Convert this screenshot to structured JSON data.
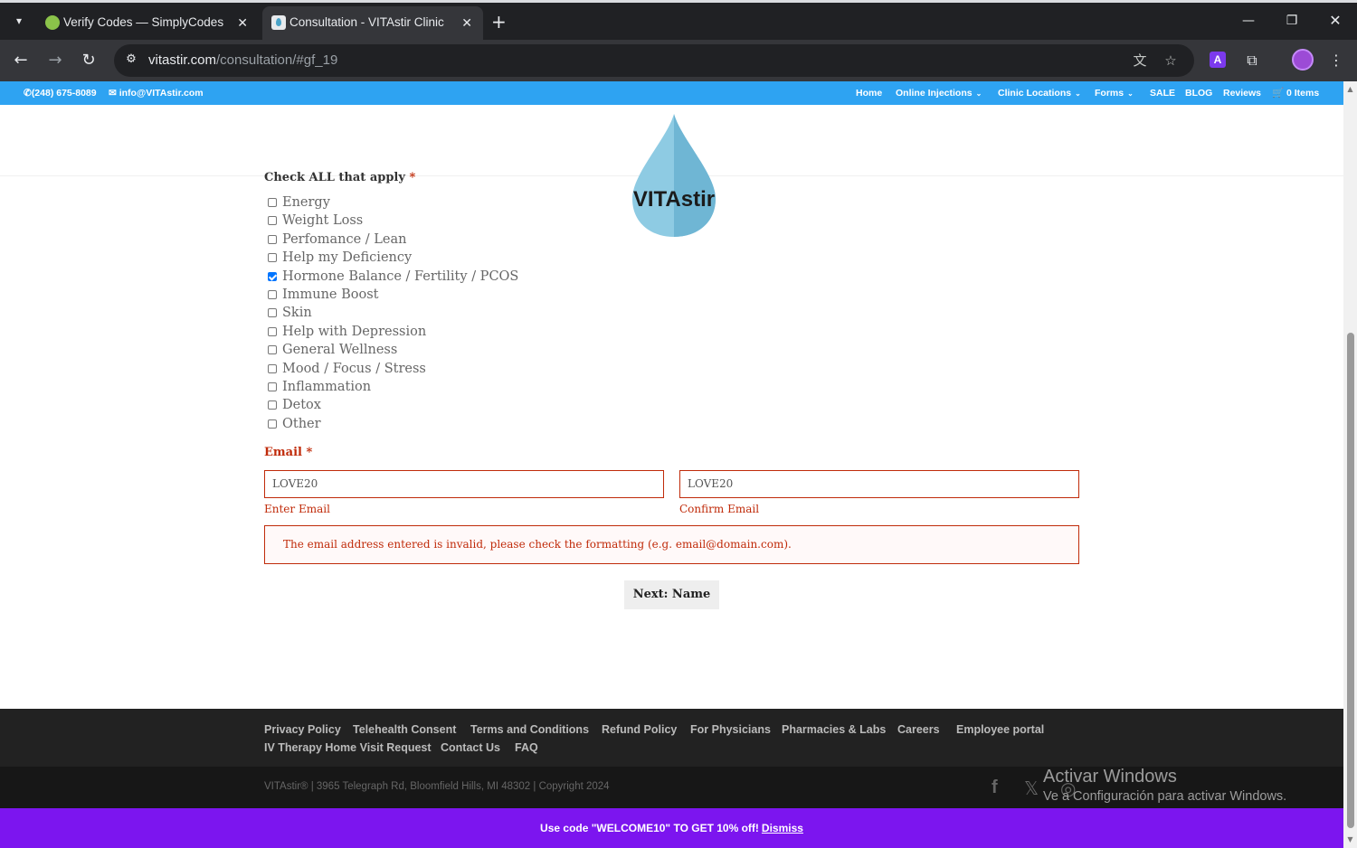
{
  "browser": {
    "tabs": [
      {
        "title": "Verify Codes — SimplyCodes",
        "active": false
      },
      {
        "title": "Consultation - VITAstir Clinic",
        "active": true
      }
    ],
    "url_host": "vitastir.com",
    "url_path": "/consultation/#gf_19",
    "icons": [
      "chevron-down-icon",
      "close-icon",
      "plus-icon",
      "minimize-icon",
      "restore-icon",
      "back-icon",
      "forward-icon",
      "reload-icon",
      "tune-icon",
      "translate-icon",
      "star-icon",
      "extension-icon",
      "profile-avatar",
      "kebab-menu-icon"
    ],
    "ext_a_label": "A"
  },
  "topbar": {
    "phone": "(248) 675-8089",
    "email": "info@VITAstir.com",
    "menu": [
      {
        "label": "Home",
        "dropdown": false
      },
      {
        "label": "Online Injections",
        "dropdown": true
      },
      {
        "label": "Clinic Locations",
        "dropdown": true
      },
      {
        "label": "Forms",
        "dropdown": true
      },
      {
        "label": "SALE",
        "dropdown": false
      },
      {
        "label": "BLOG",
        "dropdown": false
      },
      {
        "label": "Reviews",
        "dropdown": false
      }
    ],
    "cart": "0 Items"
  },
  "logo": {
    "text": "VITAstir",
    "colors": [
      "#8ecbe3",
      "#5ea9c9"
    ]
  },
  "form": {
    "checkbox_label": "Check ALL that apply",
    "required_mark": "*",
    "options": [
      {
        "label": "Energy",
        "checked": false
      },
      {
        "label": "Weight Loss",
        "checked": false
      },
      {
        "label": "Perfomance / Lean",
        "checked": false
      },
      {
        "label": "Help my Deficiency",
        "checked": false
      },
      {
        "label": "Hormone Balance / Fertility / PCOS",
        "checked": true
      },
      {
        "label": "Immune Boost",
        "checked": false
      },
      {
        "label": "Skin",
        "checked": false
      },
      {
        "label": "Help with Depression",
        "checked": false
      },
      {
        "label": "General Wellness",
        "checked": false
      },
      {
        "label": "Mood / Focus / Stress",
        "checked": false
      },
      {
        "label": "Inflammation",
        "checked": false
      },
      {
        "label": "Detox",
        "checked": false
      },
      {
        "label": "Other",
        "checked": false
      }
    ],
    "email_label": "Email",
    "email_value": "LOVE20",
    "confirm_value": "LOVE20",
    "email_sublabel": "Enter Email",
    "confirm_sublabel": "Confirm Email",
    "error": "The email address entered is invalid, please check the formatting (e.g. email@domain.com).",
    "next_button": "Next: Name",
    "error_color": "#c02b0a"
  },
  "footer": {
    "links": [
      "Privacy Policy",
      "Telehealth Consent",
      "Terms and Conditions",
      "Refund Policy",
      "For Physicians",
      "Pharmacies & Labs",
      "Careers",
      "Employee portal",
      "IV Therapy Home Visit Request",
      "Contact Us",
      "FAQ"
    ],
    "copyright": "VITAstir® | 3965 Telegraph Rd, Bloomfield Hills, MI 48302 | Copyright 2024",
    "social": [
      "facebook-icon",
      "x-icon",
      "instagram-icon"
    ]
  },
  "watermark": {
    "line1": "Activar Windows",
    "line2": "Ve a Configuración para activar Windows."
  },
  "promo": {
    "text": "Use code \"WELCOME10\" TO GET 10% off!",
    "dismiss": "Dismiss",
    "bg": "#7c15ef"
  }
}
